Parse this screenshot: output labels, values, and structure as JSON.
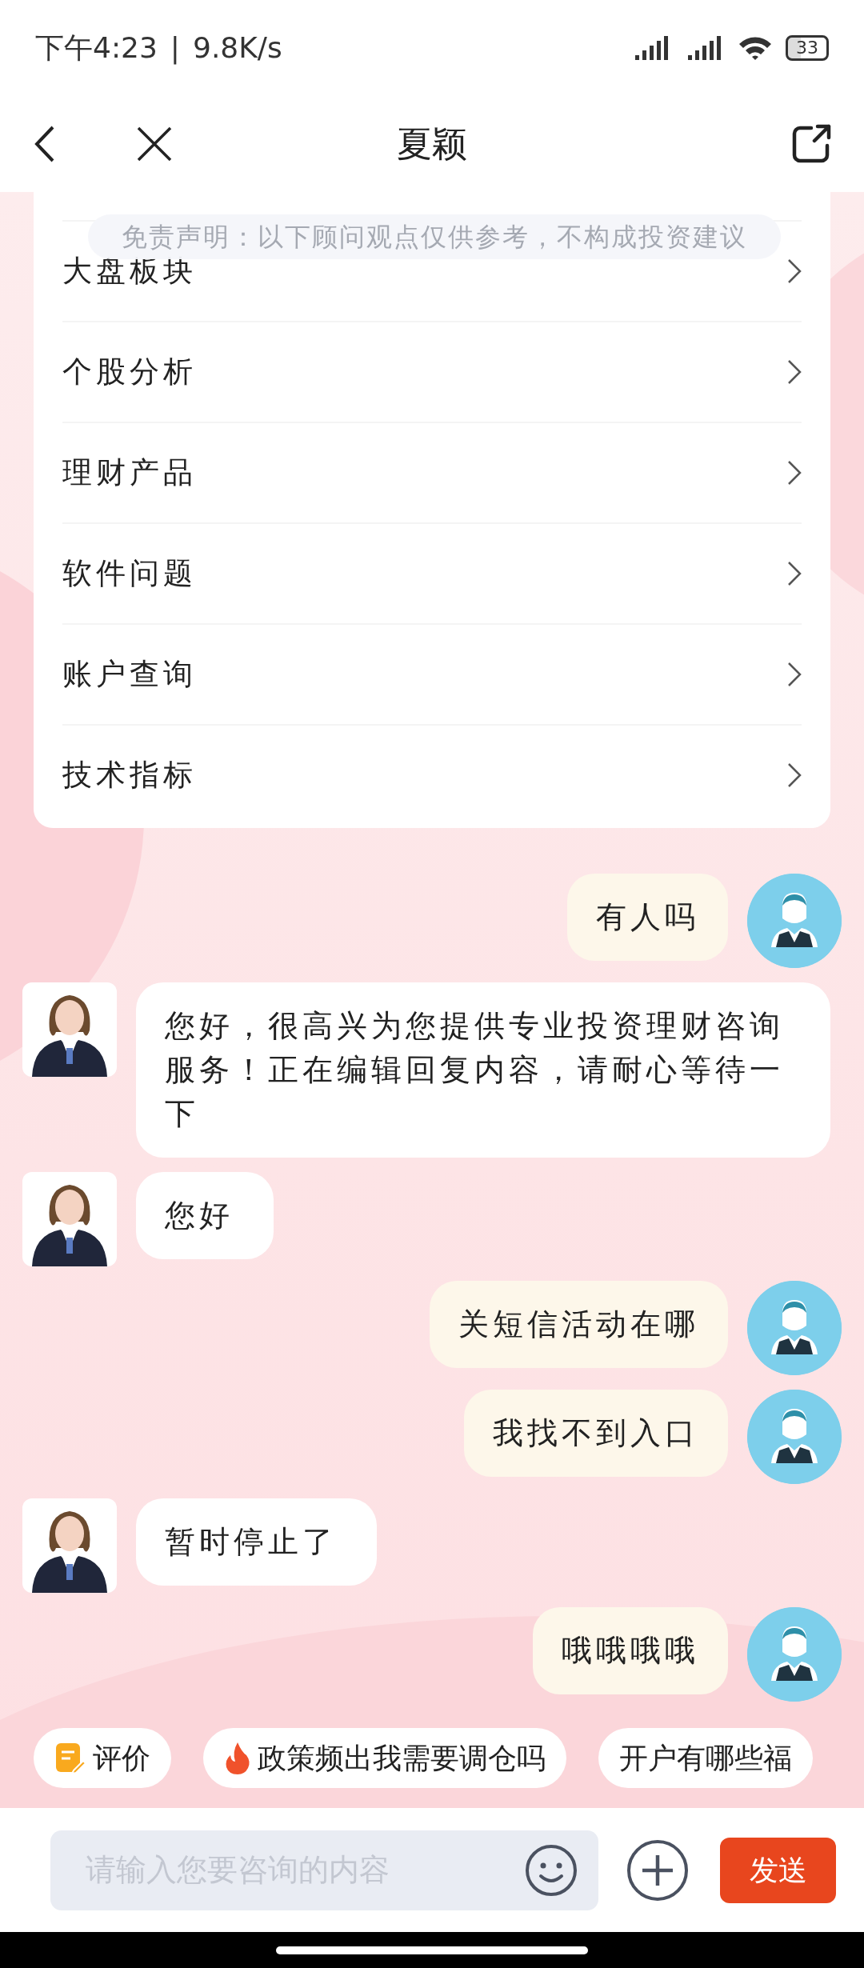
{
  "status_bar": {
    "time": "下午4:23",
    "separator": "|",
    "speed": "9.8K/s",
    "battery": "33"
  },
  "nav": {
    "title": "夏颖"
  },
  "disclaimer": "免责声明：以下顾问观点仅供参考，不构成投资建议",
  "menu_items": [
    "大盘板块",
    "个股分析",
    "理财产品",
    "软件问题",
    "账户查询",
    "技术指标"
  ],
  "messages": [
    {
      "kind": "user",
      "text": "有人吗"
    },
    {
      "kind": "agent",
      "text": "您好，很高兴为您提供专业投资理财咨询服务！正在编辑回复内容，请耐心等待一下"
    },
    {
      "kind": "agent",
      "text": "您好"
    },
    {
      "kind": "user",
      "text": "关短信活动在哪"
    },
    {
      "kind": "user",
      "text": "我找不到入口"
    },
    {
      "kind": "agent",
      "text": "暂时停止了"
    },
    {
      "kind": "user",
      "text": "哦哦哦哦"
    }
  ],
  "quick_replies": [
    {
      "kind": "note",
      "label": "评价"
    },
    {
      "kind": "hot",
      "label": "政策频出我需要调仓吗"
    },
    {
      "kind": "plain",
      "label": "开户有哪些福"
    }
  ],
  "composer": {
    "placeholder": "请输入您要咨询的内容",
    "send": "发送"
  }
}
